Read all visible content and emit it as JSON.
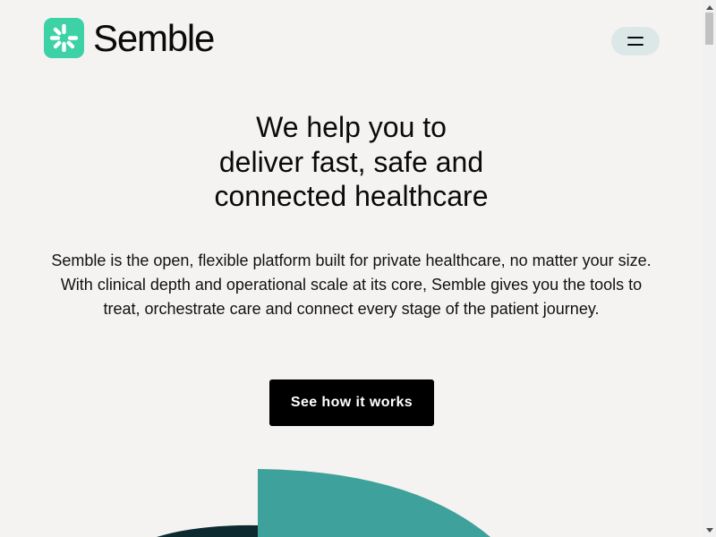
{
  "brand": {
    "name": "Semble",
    "logo_icon": "semble-spark-icon",
    "logo_color": "#3cd2a5"
  },
  "header": {
    "menu_icon": "hamburger-menu-icon",
    "menu_bg": "#dce8e8"
  },
  "hero": {
    "title_lines": [
      "We help you to",
      "deliver fast, safe and",
      "connected healthcare"
    ],
    "body": "Semble is the open, flexible platform built for private healthcare, no matter your size. With clinical depth and operational scale at its core, Semble gives you the tools to treat, orchestrate care and connect every stage of the patient journey.",
    "cta_label": "See how it works"
  },
  "graphic": {
    "teal_color": "#3fa19b",
    "dark_color": "#0c2a30"
  }
}
